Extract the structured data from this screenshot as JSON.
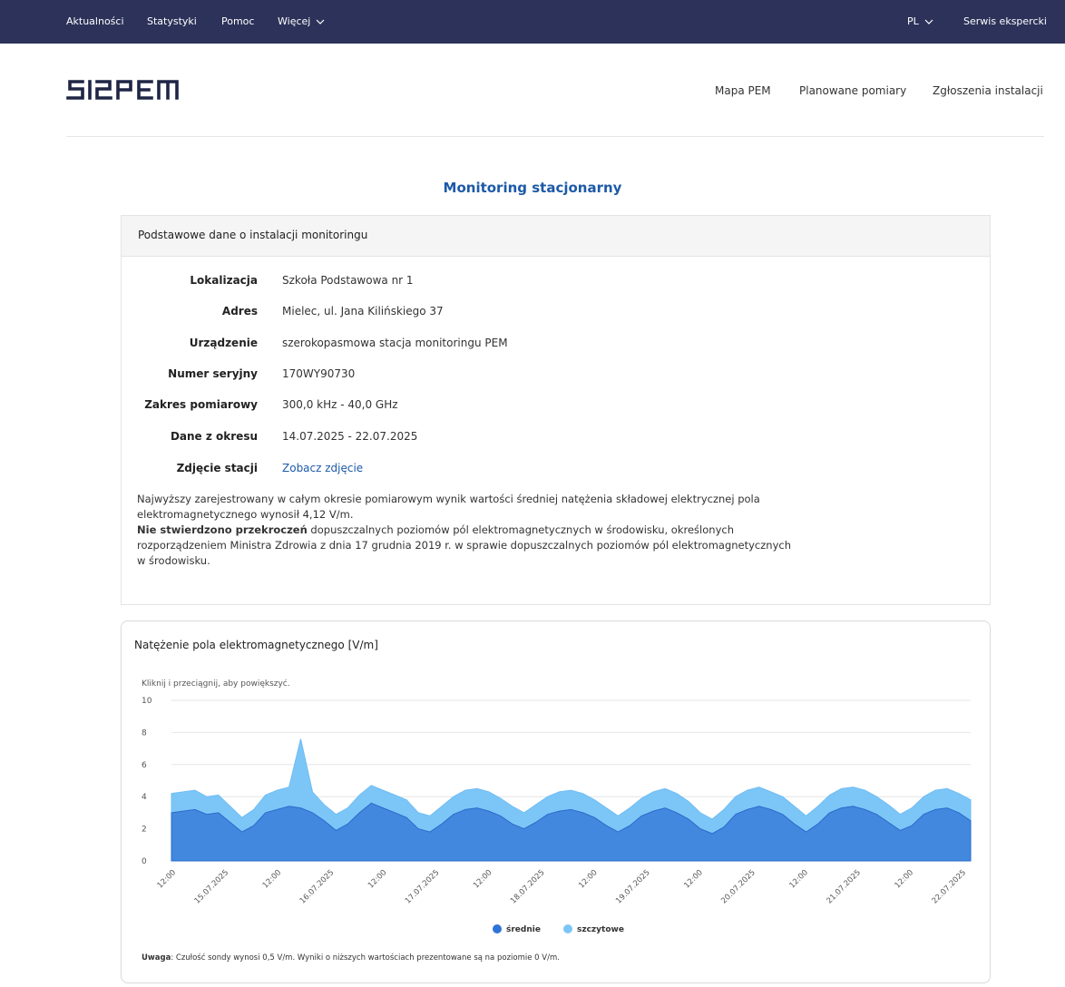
{
  "topnav": {
    "items": [
      "Aktualności",
      "Statystyki",
      "Pomoc",
      "Więcej"
    ],
    "lang": "PL",
    "expert": "Serwis ekspercki"
  },
  "brand": {
    "logo": "SI2PEM"
  },
  "mainnav": [
    "Mapa PEM",
    "Planowane pomiary",
    "Zgłoszenia instalacji"
  ],
  "page_title": "Monitoring stacjonarny",
  "info": {
    "header": "Podstawowe dane o instalacji monitoringu",
    "rows": [
      {
        "label": "Lokalizacja",
        "value": "Szkoła Podstawowa nr 1"
      },
      {
        "label": "Adres",
        "value": "Mielec, ul. Jana Kilińskiego 37"
      },
      {
        "label": "Urządzenie",
        "value": "szerokopasmowa stacja monitoringu PEM"
      },
      {
        "label": "Numer seryjny",
        "value": "170WY90730"
      },
      {
        "label": "Zakres pomiarowy",
        "value": "300,0 kHz - 40,0 GHz"
      },
      {
        "label": "Dane z okresu",
        "value": "14.07.2025 - 22.07.2025"
      },
      {
        "label": "Zdjęcie stacji",
        "value": "Zobacz zdjęcie"
      }
    ],
    "summary_line1": "Najwyższy zarejestrowany w całym okresie pomiarowym wynik wartości średniej natężenia składowej elektrycznej pola",
    "summary_line2": "elektromagnetycznego wynosił 4,12 V/m.",
    "exceed_bold": "Nie stwierdzono przekroczeń",
    "exceed_line1": " dopuszczalnych poziomów pól elektromagnetycznych w środowisku, określonych",
    "exceed_line2": "rozporządzeniem Ministra Zdrowia z dnia 17 grudnia 2019 r. w sprawie dopuszczalnych poziomów pól elektromagnetycznych",
    "exceed_line3": "w środowisku."
  },
  "chart_section": {
    "title": "Natężenie pola elektromagnetycznego [V/m]",
    "hint": "Kliknij i przeciągnij, aby powiększyć.",
    "note_bold": "Uwaga",
    "note_text": ": Czułość sondy wynosi 0,5 V/m. Wyniki o niższych wartościach prezentowane są na poziomie 0 V/m."
  },
  "colors": {
    "topbar": "#2c3259",
    "accent": "#1d5aa8",
    "series_avg": "#2f73d6",
    "series_peak": "#7cc6f7"
  },
  "chart_data": {
    "type": "area",
    "title": "",
    "xlabel": "",
    "ylabel": "",
    "ylim": [
      0,
      10
    ],
    "yticks": [
      0,
      2,
      4,
      6,
      8,
      10
    ],
    "xtick_labels": [
      "12:00",
      "15.07.2025",
      "12:00",
      "16.07.2025",
      "12:00",
      "17.07.2025",
      "12:00",
      "18.07.2025",
      "12:00",
      "19.07.2025",
      "12:00",
      "20.07.2025",
      "12:00",
      "21.07.2025",
      "12:00",
      "22.07.2025"
    ],
    "x": [
      "14.07 09:00",
      "14.07 12:00",
      "14.07 15:00",
      "14.07 18:00",
      "14.07 21:00",
      "15.07 00:00",
      "15.07 03:00",
      "15.07 06:00",
      "15.07 09:00",
      "15.07 12:00",
      "15.07 15:00",
      "15.07 18:00",
      "15.07 21:00",
      "16.07 00:00",
      "16.07 03:00",
      "16.07 06:00",
      "16.07 09:00",
      "16.07 12:00",
      "16.07 15:00",
      "16.07 18:00",
      "16.07 21:00",
      "17.07 00:00",
      "17.07 03:00",
      "17.07 06:00",
      "17.07 09:00",
      "17.07 12:00",
      "17.07 15:00",
      "17.07 18:00",
      "17.07 21:00",
      "18.07 00:00",
      "18.07 03:00",
      "18.07 06:00",
      "18.07 09:00",
      "18.07 12:00",
      "18.07 15:00",
      "18.07 18:00",
      "18.07 21:00",
      "19.07 00:00",
      "19.07 03:00",
      "19.07 06:00",
      "19.07 09:00",
      "19.07 12:00",
      "19.07 15:00",
      "19.07 18:00",
      "19.07 21:00",
      "20.07 00:00",
      "20.07 03:00",
      "20.07 06:00",
      "20.07 09:00",
      "20.07 12:00",
      "20.07 15:00",
      "20.07 18:00",
      "20.07 21:00",
      "21.07 00:00",
      "21.07 03:00",
      "21.07 06:00",
      "21.07 09:00",
      "21.07 12:00",
      "21.07 15:00",
      "21.07 18:00",
      "21.07 21:00",
      "22.07 00:00",
      "22.07 03:00",
      "22.07 06:00",
      "22.07 09:00",
      "22.07 12:00",
      "22.07 15:00",
      "22.07 18:00",
      "22.07 21:00"
    ],
    "series": [
      {
        "name": "średnie",
        "values": [
          3.0,
          3.1,
          3.2,
          2.9,
          3.0,
          2.4,
          1.8,
          2.2,
          3.0,
          3.2,
          3.4,
          3.3,
          3.0,
          2.5,
          1.9,
          2.3,
          3.0,
          3.6,
          3.3,
          3.0,
          2.7,
          2.0,
          1.8,
          2.3,
          2.9,
          3.2,
          3.3,
          3.1,
          2.8,
          2.3,
          2.0,
          2.4,
          2.9,
          3.1,
          3.2,
          3.0,
          2.7,
          2.2,
          1.8,
          2.2,
          2.8,
          3.1,
          3.3,
          3.0,
          2.6,
          2.0,
          1.7,
          2.1,
          2.9,
          3.2,
          3.4,
          3.2,
          2.9,
          2.3,
          1.8,
          2.3,
          3.0,
          3.3,
          3.4,
          3.2,
          2.9,
          2.4,
          1.9,
          2.2,
          2.9,
          3.2,
          3.3,
          3.0,
          2.5
        ]
      },
      {
        "name": "szczytowe",
        "values": [
          4.2,
          4.3,
          4.4,
          4.0,
          4.1,
          3.4,
          2.7,
          3.2,
          4.1,
          4.4,
          4.6,
          7.6,
          4.3,
          3.5,
          2.9,
          3.3,
          4.1,
          4.7,
          4.4,
          4.1,
          3.8,
          3.0,
          2.8,
          3.4,
          4.0,
          4.4,
          4.5,
          4.3,
          3.9,
          3.4,
          3.0,
          3.5,
          4.0,
          4.3,
          4.4,
          4.2,
          3.8,
          3.3,
          2.8,
          3.3,
          3.9,
          4.3,
          4.5,
          4.2,
          3.7,
          3.0,
          2.6,
          3.2,
          4.0,
          4.4,
          4.6,
          4.3,
          4.0,
          3.4,
          2.8,
          3.4,
          4.1,
          4.5,
          4.6,
          4.4,
          4.0,
          3.5,
          2.9,
          3.3,
          4.0,
          4.4,
          4.5,
          4.2,
          3.8
        ]
      }
    ],
    "legend": "bottom-center",
    "grid": true
  }
}
